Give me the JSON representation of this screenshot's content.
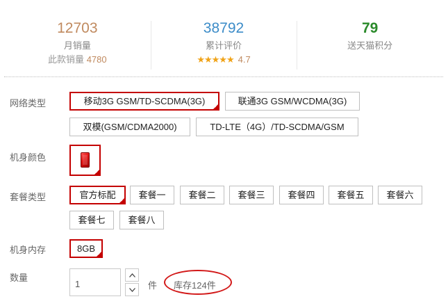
{
  "stats": {
    "monthly_sales": {
      "value": "12703",
      "label": "月销量",
      "sub_label": "此款销量",
      "sub_value": "4780"
    },
    "reviews": {
      "value": "38792",
      "label": "累计评价",
      "stars": "★★★★★",
      "rating": "4.7"
    },
    "points": {
      "value": "79",
      "label": "送天猫积分"
    }
  },
  "options": {
    "network": {
      "label": "网络类型",
      "items": [
        "移动3G GSM/TD-SCDMA(3G)",
        "联通3G GSM/WCDMA(3G)",
        "双模(GSM/CDMA2000)",
        "TD-LTE（4G）/TD-SCDMA/GSM"
      ],
      "selected": "移动3G GSM/TD-SCDMA(3G)"
    },
    "color": {
      "label": "机身颜色",
      "swatch_color": "#e01010"
    },
    "package": {
      "label": "套餐类型",
      "items": [
        "官方标配",
        "套餐一",
        "套餐二",
        "套餐三",
        "套餐四",
        "套餐五",
        "套餐六",
        "套餐七",
        "套餐八"
      ],
      "selected": "官方标配"
    },
    "storage": {
      "label": "机身内存",
      "items": [
        "8GB"
      ],
      "selected": "8GB"
    }
  },
  "quantity": {
    "label": "数量",
    "value": "1",
    "unit": "件",
    "stock": "库存124件"
  },
  "colors": {
    "accent": "#c40000",
    "price": "#c08a5f",
    "link_blue": "#3c8cc8",
    "points_green": "#2a8a2a",
    "star": "#f0a318"
  }
}
